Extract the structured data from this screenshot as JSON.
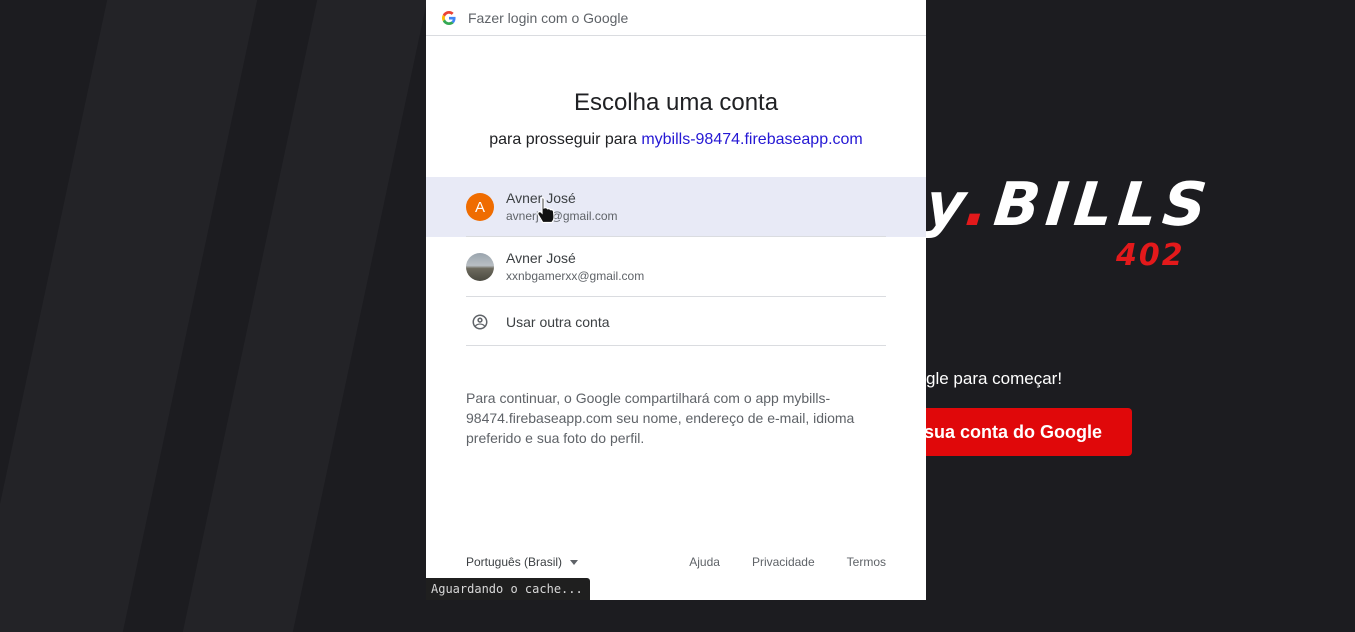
{
  "background_app": {
    "logo_partial": "y",
    "logo_dot": ".",
    "logo_rest": "BILLS",
    "logo_sub": "402",
    "prompt_text": "gle para começar!",
    "button_label": "sua conta do Google",
    "accent_color": "#e0080a"
  },
  "popup": {
    "window_title": "Fazer login com o Google",
    "heading": "Escolha uma conta",
    "subheading_prefix": "para prosseguir para ",
    "app_domain": "mybills-98474.firebaseapp.com",
    "accounts": [
      {
        "avatar_letter": "A",
        "name": "Avner José",
        "email": "avnerj…@gmail.com",
        "selected": true
      },
      {
        "avatar_letter": "",
        "name": "Avner José",
        "email": "xxnbgamerxx@gmail.com",
        "selected": false
      }
    ],
    "use_other": "Usar outra conta",
    "disclaimer": "Para continuar, o Google compartilhará com o app mybills-98474.firebaseapp.com seu nome, endereço de e-mail, idioma preferido e sua foto do perfil.",
    "language": "Português (Brasil)",
    "footer_links": {
      "help": "Ajuda",
      "privacy": "Privacidade",
      "terms": "Termos"
    }
  },
  "status_bar": "Aguardando o cache..."
}
